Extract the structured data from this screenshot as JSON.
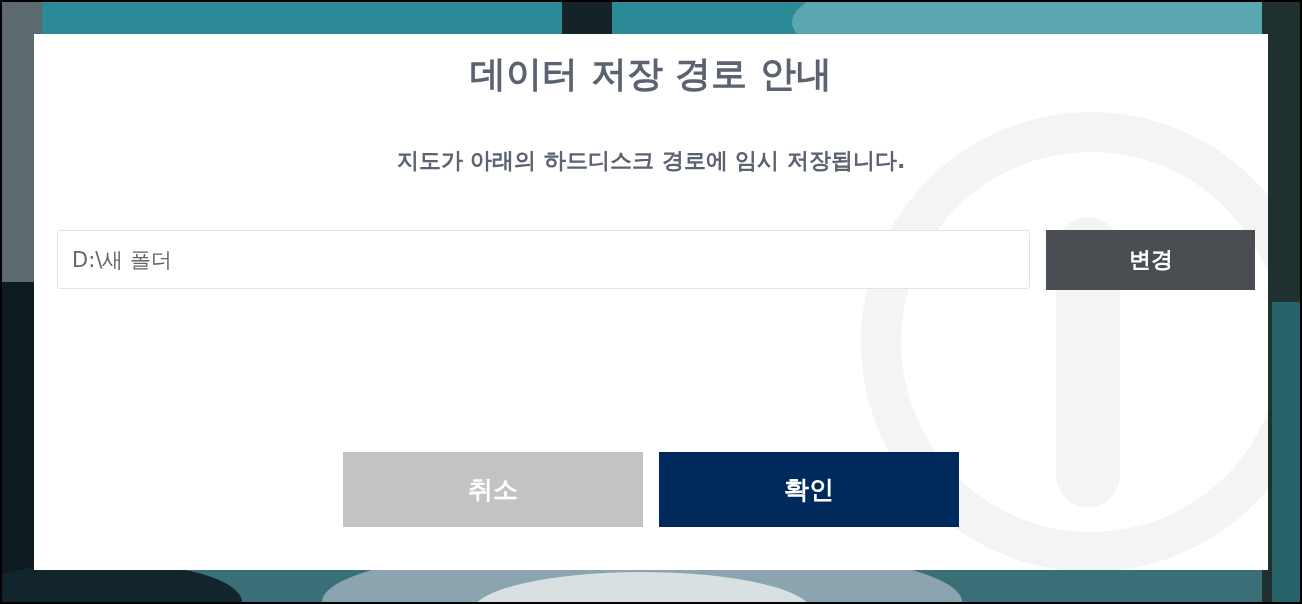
{
  "dialog": {
    "title": "데이터 저장 경로 안내",
    "message": "지도가 아래의 하드디스크 경로에 임시 저장됩니다.",
    "path_field": {
      "value": "D:\\새 폴더"
    },
    "change_button": {
      "label": "변경"
    },
    "buttons": [
      {
        "label": "취소",
        "kind": "cancel"
      },
      {
        "label": "확인",
        "kind": "confirm"
      }
    ]
  }
}
